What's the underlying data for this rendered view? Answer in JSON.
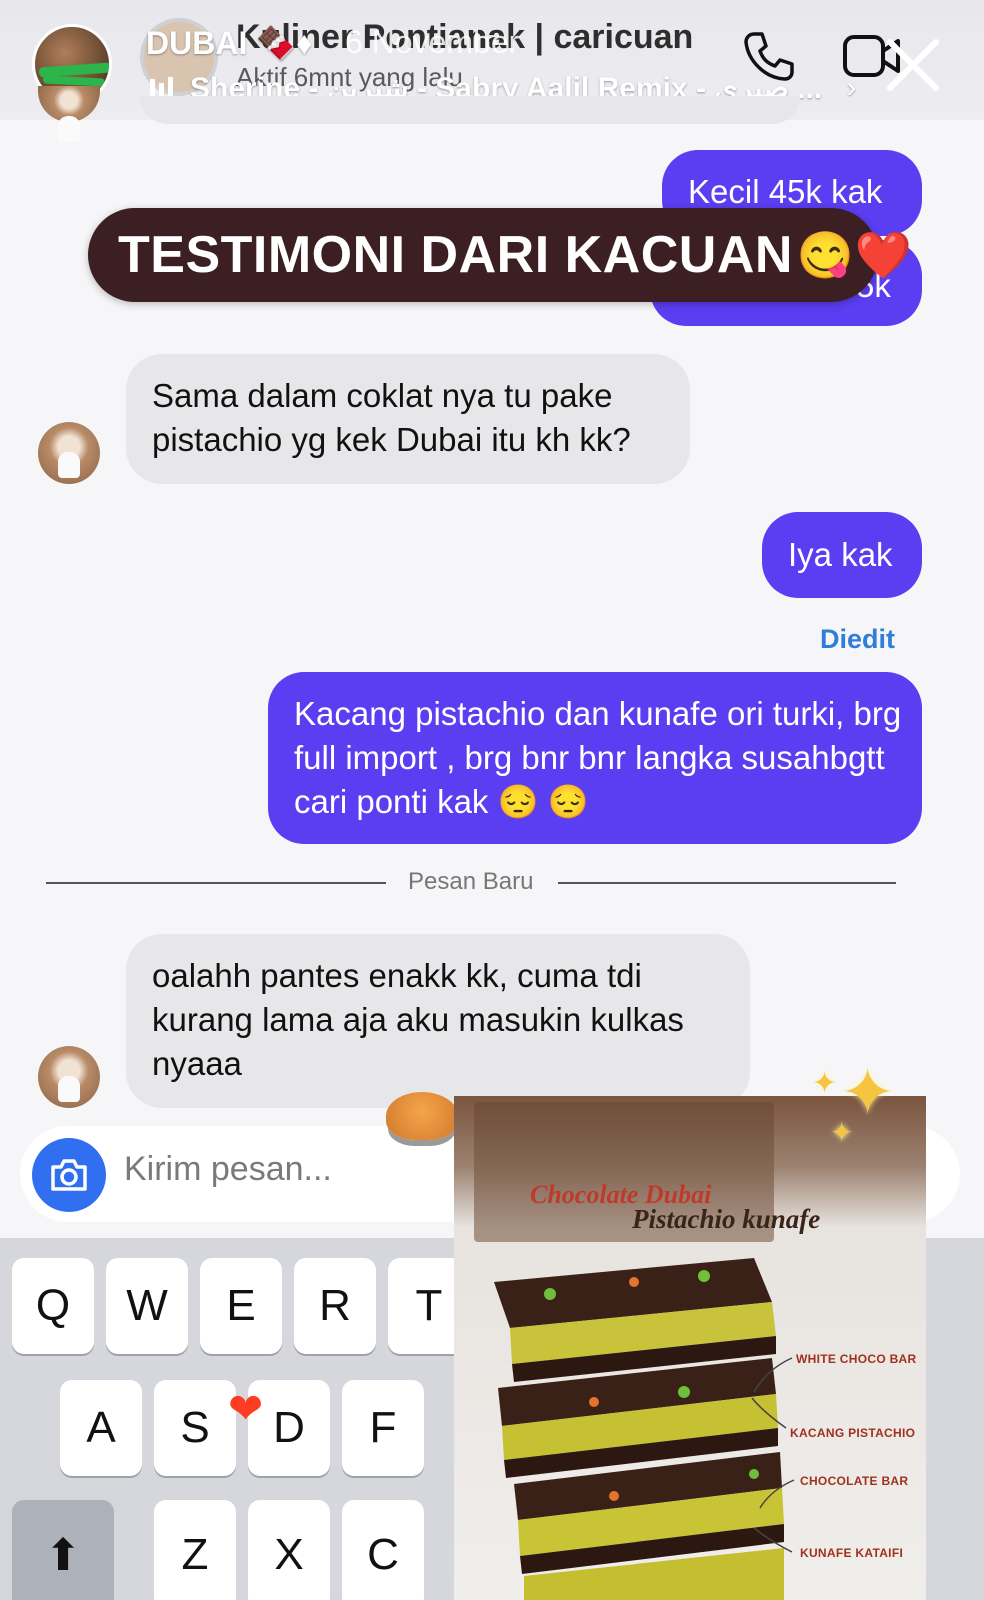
{
  "story": {
    "title": "DUBAI 🍫♦",
    "date": "6 November",
    "music": "Sherine - شيرين - Sabry Aalil Remix - صبري ...",
    "music_chevron": "›"
  },
  "chat": {
    "contact_name": "Kuliner Pontianak | caricuan",
    "contact_status": "Aktif 6mnt yang lalu"
  },
  "banner": {
    "text": "TESTIMONI DARI KACUAN",
    "emoji": "😋❤️"
  },
  "messages": {
    "out1": "Kecil 45k kak",
    "out2_partial": "5k",
    "in1": "Sama dalam coklat nya tu pake pistachio yg kek Dubai itu kh kk?",
    "out3": "Iya kak",
    "edited_label": "Diedit",
    "out4": "Kacang pistachio dan kunafe ori turki, brg full import , brg bnr bnr langka susahbgtt cari ponti kak 😔 😔",
    "divider_label": "Pesan Baru",
    "in2": "oalahh pantes enakk kk, cuma tdi kurang lama aja aku masukin kulkas nyaaa"
  },
  "composer": {
    "placeholder": "Kirim pesan..."
  },
  "keyboard": {
    "row1": [
      "Q",
      "W",
      "E",
      "R",
      "T"
    ],
    "row2": [
      "A",
      "S",
      "D",
      "F"
    ],
    "row3": [
      "Z",
      "X",
      "C"
    ],
    "shift": "⬆"
  },
  "promo": {
    "title_line1": "Chocolate Dubai",
    "title_line2": "Pistachio kunafe",
    "labels": [
      "WHITE CHOCO BAR",
      "KACANG PISTACHIO",
      "CHOCOLATE BAR",
      "KUNAFE KATAIFI"
    ]
  }
}
